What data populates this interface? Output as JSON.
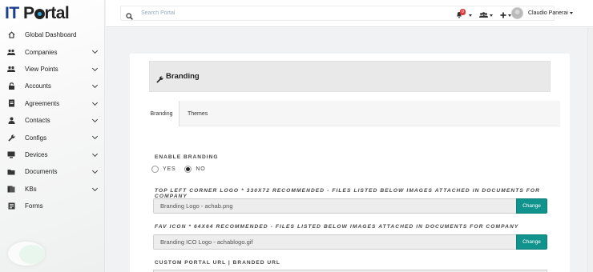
{
  "app": {
    "logo_text_it": "IT",
    "logo_text_p": "P",
    "logo_text_rest": "rtal"
  },
  "sidebar": {
    "items": [
      {
        "label": "Global Dashboard",
        "icon": "home-icon",
        "chevron": false
      },
      {
        "label": "Companies",
        "icon": "people-icon",
        "chevron": true
      },
      {
        "label": "View Points",
        "icon": "eye-icon",
        "chevron": true
      },
      {
        "label": "Accounts",
        "icon": "lock-icon",
        "chevron": true
      },
      {
        "label": "Agreements",
        "icon": "file-icon",
        "chevron": true
      },
      {
        "label": "Contacts",
        "icon": "user-icon",
        "chevron": true
      },
      {
        "label": "Configs",
        "icon": "wrench-icon",
        "chevron": true
      },
      {
        "label": "Devices",
        "icon": "desktop-icon",
        "chevron": true
      },
      {
        "label": "Documents",
        "icon": "folder-icon",
        "chevron": true
      },
      {
        "label": "KBs",
        "icon": "book-icon",
        "chevron": true
      },
      {
        "label": "Forms",
        "icon": "form-icon",
        "chevron": false
      }
    ]
  },
  "topbar": {
    "search_placeholder": "Search Portal",
    "notification_count": "0",
    "user_name": "Claudio Panerai"
  },
  "panel": {
    "title": "Branding",
    "tabs": [
      {
        "label": "Branding",
        "active": true
      },
      {
        "label": "Themes",
        "active": false
      }
    ]
  },
  "form": {
    "enable_branding_label": "ENABLE BRANDING",
    "radio_yes": "YES",
    "radio_no": "NO",
    "radio_selected": "NO",
    "logo_label": "TOP LEFT CORNER LOGO * 330X72 RECOMMENDED - FILES LISTED BELOW IMAGES ATTACHED IN DOCUMENTS FOR COMPANY",
    "logo_value": "Branding Logo - achab.png",
    "logo_button": "Change",
    "fav_label": "FAV ICON * 64X64 RECOMMENDED - FILES LISTED BELOW IMAGES ATTACHED IN DOCUMENTS FOR COMPANY",
    "fav_value": "Branding ICO Logo - achablogo.gif",
    "fav_button": "Change",
    "url_label": "CUSTOM PORTAL URL | BRANDED URL"
  },
  "colors": {
    "accent": "#11938d",
    "badge": "#e33b3b",
    "logo_blue": "#1c3f8c"
  }
}
